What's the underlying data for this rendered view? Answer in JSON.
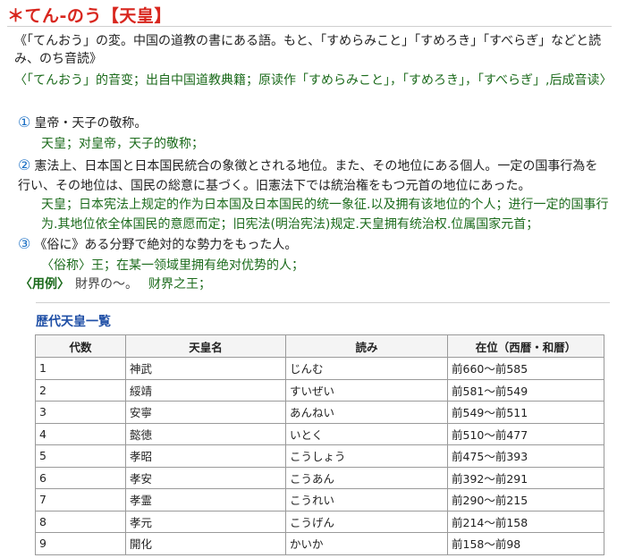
{
  "headword": "＊てん-のう【天皇】",
  "etymology": "《「てんおう」の変。中国の道教の書にある語。もと、「すめらみこと」「すめろき」「すべらぎ」などと読み、のち音読》",
  "etymology_zh": "〈「てんおう」的音变；出自中国道教典籍；原读作「すめらみこと」，「すめろき」，「すべらぎ」,后成音读〉",
  "senses": [
    {
      "num": "①",
      "text": "皇帝・天子の敬称。",
      "zh": "天皇；对皇帝，天子的敬称；"
    },
    {
      "num": "②",
      "text": "憲法上、日本国と日本国民統合の象徴とされる地位。また、その地位にある個人。一定の国事行為を行い、その地位は、国民の総意に基づく。旧憲法下では統治権をもつ元首の地位にあった。",
      "zh": "天皇；日本宪法上规定的作为日本国及日本国民的统一象征.以及拥有该地位的个人；进行一定的国事行为.其地位依全体国民的意愿而定；旧宪法(明治宪法)规定.天皇拥有统治权.位属国家元首；"
    },
    {
      "num": "③",
      "text": "《俗に》ある分野で絶対的な勢力をもった人。",
      "zh": "〈俗称〉王；在某一领域里拥有绝对优势的人；"
    }
  ],
  "example": {
    "label": "〈用例〉",
    "text": "財界の～。",
    "zh": "财界之王；"
  },
  "table": {
    "title": "歴代天皇一覧",
    "headers": [
      "代数",
      "天皇名",
      "読み",
      "在位（西暦・和暦）"
    ],
    "rows": [
      [
        "1",
        "神武",
        "じんむ",
        "前660～前585"
      ],
      [
        "2",
        "綏靖",
        "すいぜい",
        "前581～前549"
      ],
      [
        "3",
        "安寧",
        "あんねい",
        "前549～前511"
      ],
      [
        "4",
        "懿徳",
        "いとく",
        "前510～前477"
      ],
      [
        "5",
        "孝昭",
        "こうしょう",
        "前475～前393"
      ],
      [
        "6",
        "孝安",
        "こうあん",
        "前392～前291"
      ],
      [
        "7",
        "孝霊",
        "こうれい",
        "前290～前215"
      ],
      [
        "8",
        "孝元",
        "こうげん",
        "前214～前158"
      ],
      [
        "9",
        "開化",
        "かいか",
        "前158～前98"
      ]
    ]
  }
}
